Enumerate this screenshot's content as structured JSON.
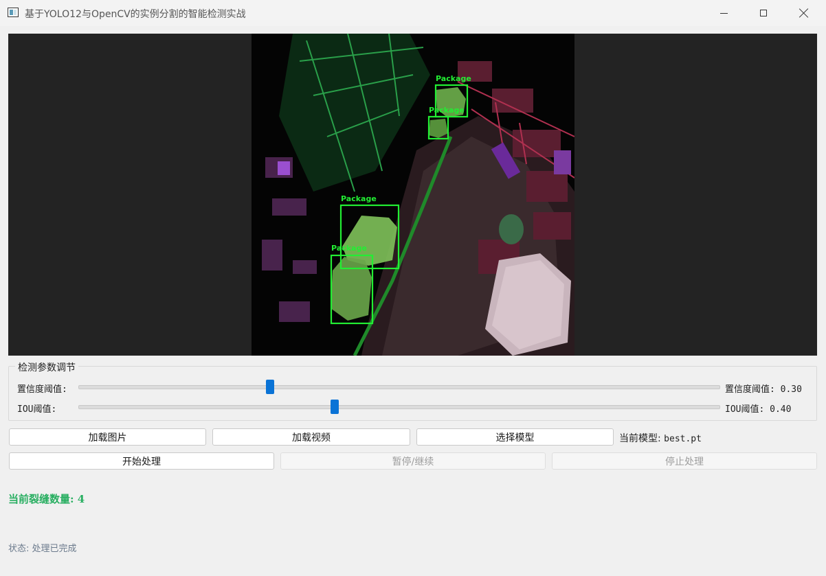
{
  "window": {
    "title": "基于YOLO12与OpenCV的实例分割的智能检测实战"
  },
  "detections": [
    {
      "label": "Package"
    },
    {
      "label": "Package"
    },
    {
      "label": "Package"
    },
    {
      "label": "Package"
    }
  ],
  "params": {
    "group_title": "检测参数调节",
    "confidence": {
      "label": "置信度阈值:",
      "value_text": "置信度阈值: 0.30",
      "value": 0.3
    },
    "iou": {
      "label": "IOU阈值:",
      "value_text": "IOU阈值: 0.40",
      "value": 0.4
    }
  },
  "buttons": {
    "load_image": "加载图片",
    "load_video": "加载视频",
    "select_model": "选择模型",
    "start": "开始处理",
    "pause_resume": "暂停/继续",
    "stop": "停止处理"
  },
  "model": {
    "label": "当前模型:",
    "name": "best.pt"
  },
  "result": {
    "count_text": "当前裂缝数量: 4"
  },
  "status": {
    "text": "状态: 处理已完成"
  },
  "colors": {
    "accent": "#0a73d6",
    "detection": "#22ee33",
    "count": "#27ae60"
  }
}
